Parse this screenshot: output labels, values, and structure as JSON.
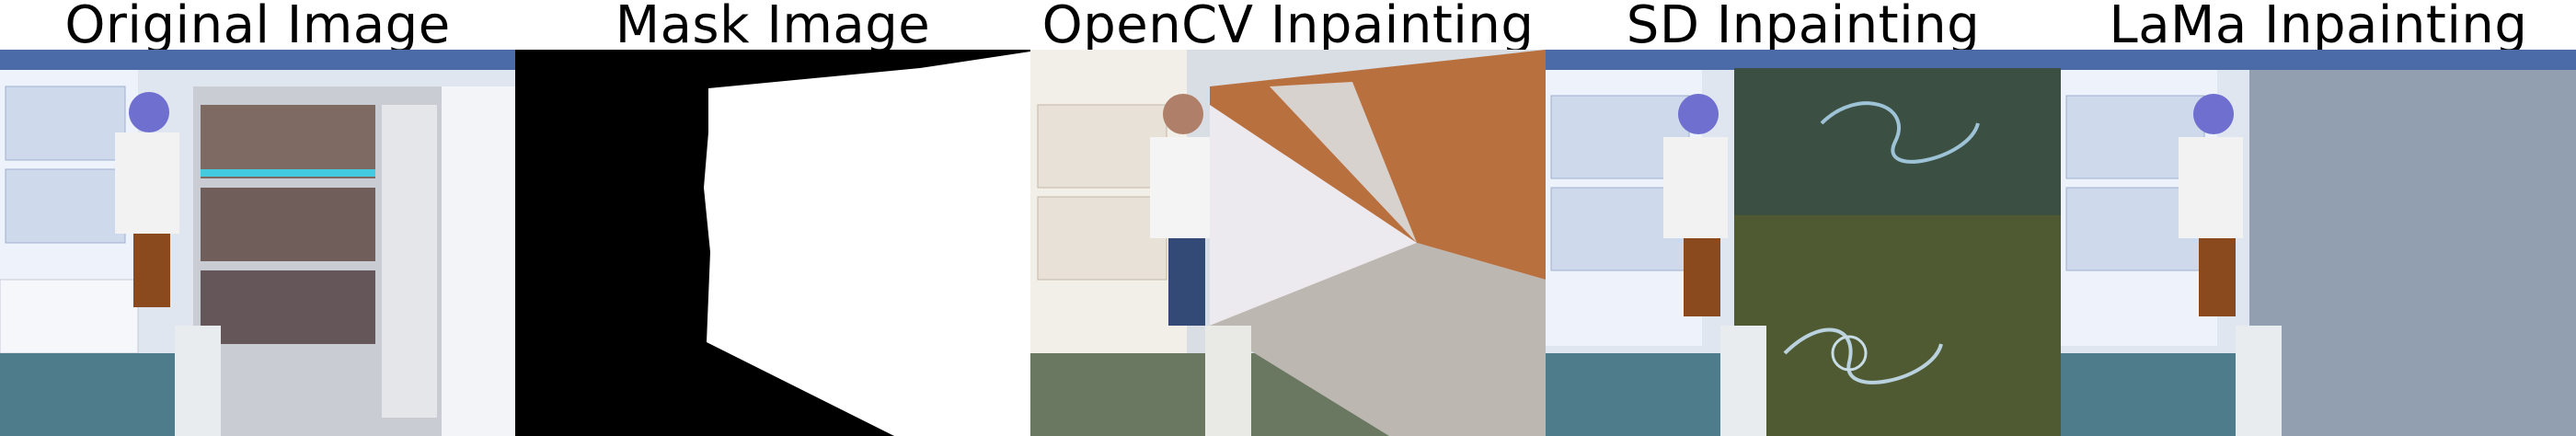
{
  "panels": [
    {
      "title": "Original Image"
    },
    {
      "title": "Mask Image"
    },
    {
      "title": "OpenCV Inpainting"
    },
    {
      "title": "SD Inpainting"
    },
    {
      "title": "LaMa Inpainting"
    }
  ]
}
